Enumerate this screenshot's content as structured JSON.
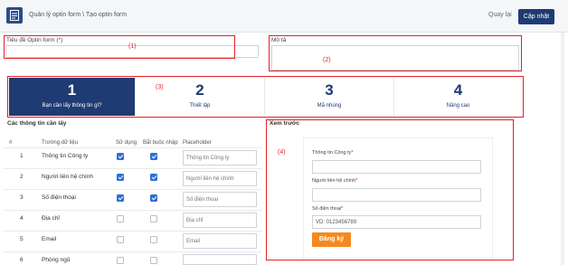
{
  "header": {
    "breadcrumb": "Quản lý optin form \\ Tạo optin form",
    "back_label": "Quay lại",
    "update_label": "Cập nhật"
  },
  "form": {
    "title_label": "Tiêu đề Optin form (*)",
    "title_value": "",
    "desc_label": "Mô tả",
    "desc_value": ""
  },
  "annotations": [
    "(1)",
    "(2)",
    "(3)",
    "(4)"
  ],
  "steps": [
    {
      "num": "1",
      "label": "Bạn cần lấy thông tin gì?",
      "active": true
    },
    {
      "num": "2",
      "label": "Thiết lập",
      "active": false
    },
    {
      "num": "3",
      "label": "Mã nhúng",
      "active": false
    },
    {
      "num": "4",
      "label": "Nâng cao",
      "active": false
    }
  ],
  "info_section": {
    "title": "Các thông tin cần lấy",
    "columns": [
      "#",
      "Trường dữ liệu",
      "Sử dụng",
      "Bắt buộc nhập",
      "Placeholder"
    ],
    "rows": [
      {
        "idx": "1",
        "field": "Thông tin Công ty",
        "use": true,
        "required": true,
        "placeholder": "Thông tin Công ty"
      },
      {
        "idx": "2",
        "field": "Người liên hệ chính",
        "use": true,
        "required": true,
        "placeholder": "Người liên hệ chính"
      },
      {
        "idx": "3",
        "field": "Số điện thoại",
        "use": true,
        "required": true,
        "placeholder": "Số điện thoại"
      },
      {
        "idx": "4",
        "field": "Địa chỉ",
        "use": false,
        "required": false,
        "placeholder": "Địa chỉ"
      },
      {
        "idx": "5",
        "field": "Email",
        "use": false,
        "required": false,
        "placeholder": "Email"
      },
      {
        "idx": "6",
        "field": "Phòng ngủ",
        "use": false,
        "required": false,
        "placeholder": ""
      }
    ]
  },
  "preview": {
    "title": "Xem trước",
    "fields": [
      {
        "label": "Thông tin Công ty",
        "required_mark": "*",
        "value": ""
      },
      {
        "label": "Người liên hệ chính",
        "required_mark": "*",
        "value": ""
      },
      {
        "label": "Số điện thoại",
        "required_mark": "*",
        "value": "VD: 0123456789"
      }
    ],
    "submit_label": "Đăng ký"
  },
  "colors": {
    "primary": "#1f3b73",
    "annotation": "#e0202a",
    "checkbox": "#2f6fd6",
    "submit": "#f5891f"
  }
}
